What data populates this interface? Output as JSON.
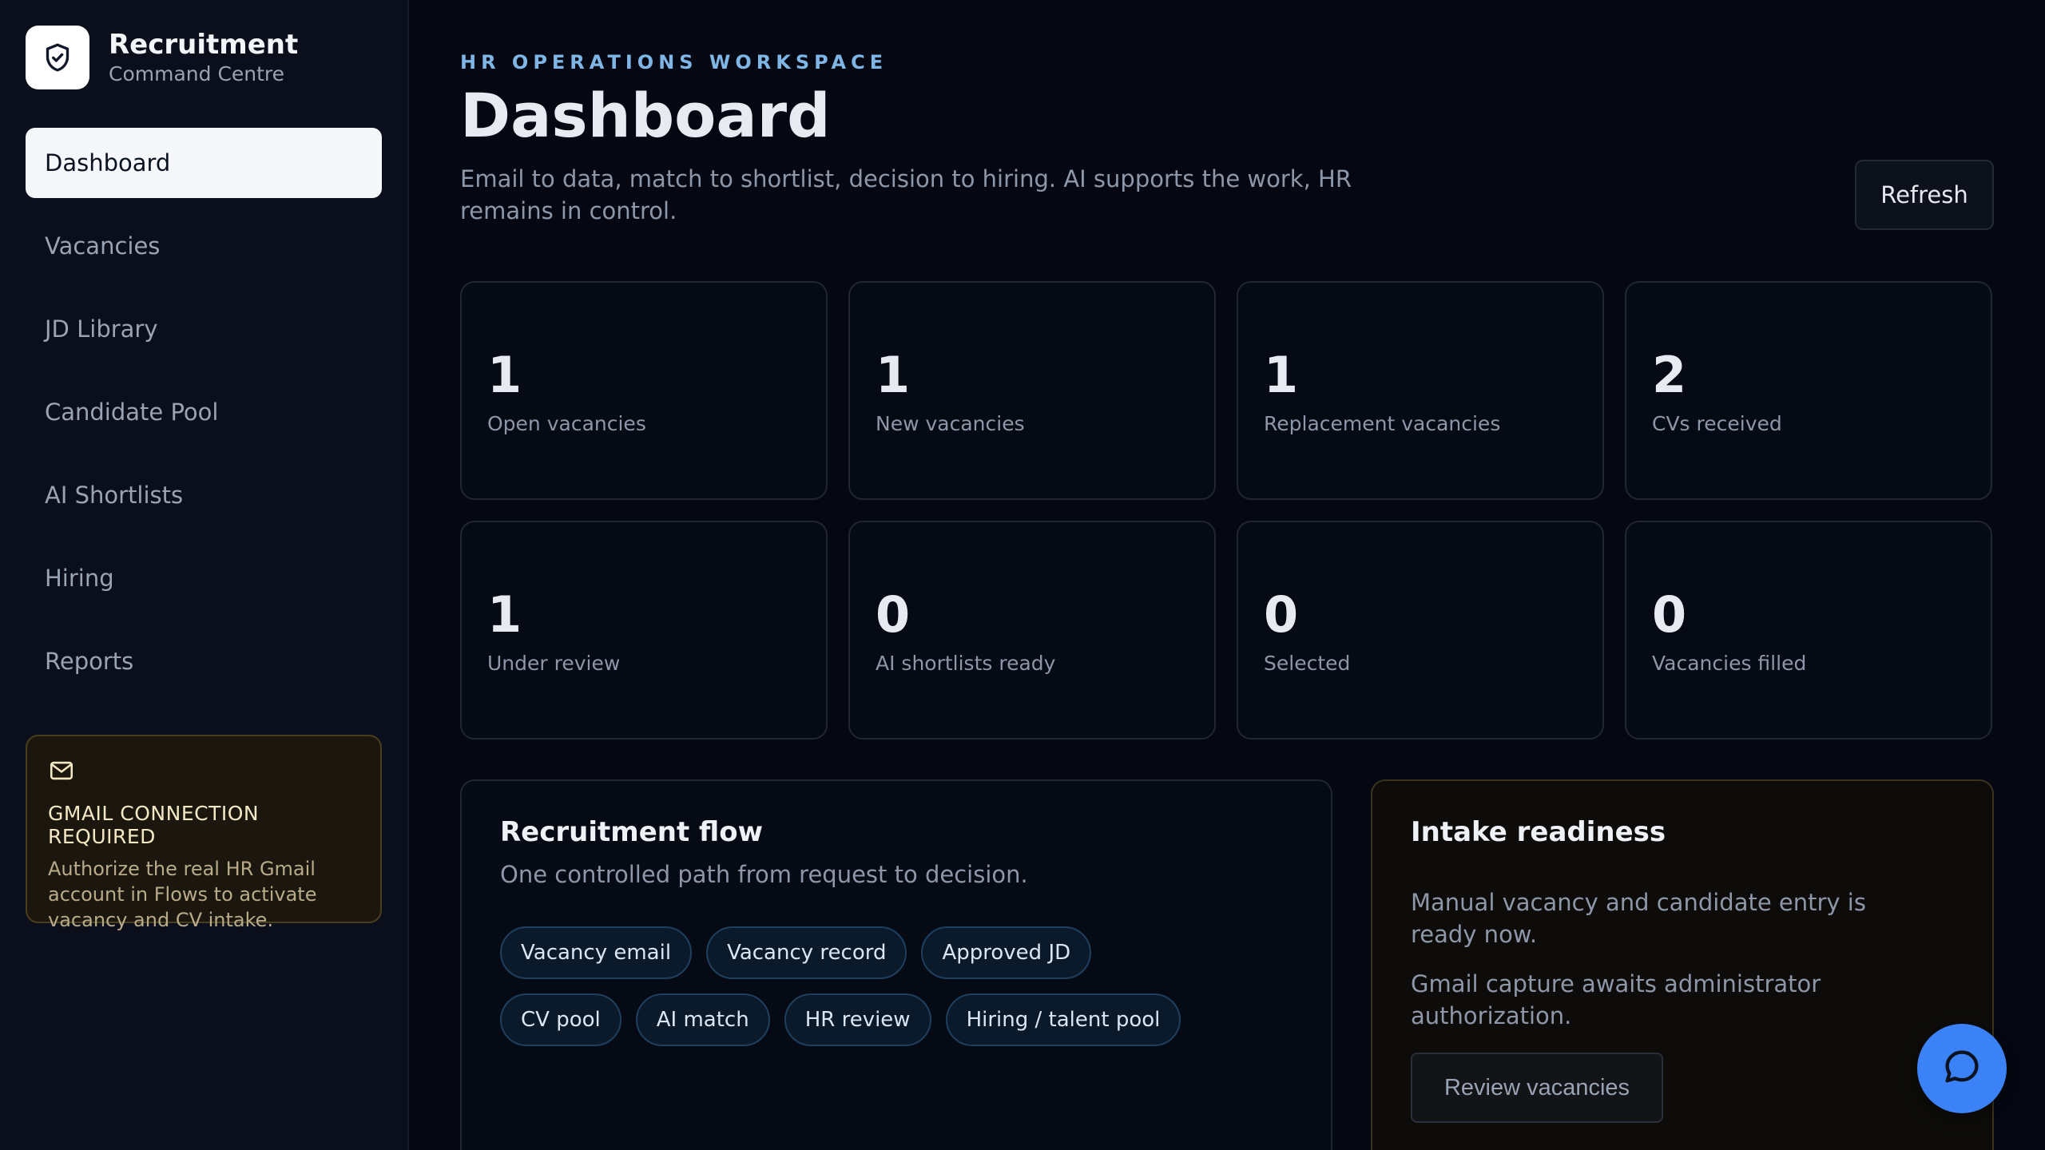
{
  "brand": {
    "title": "Recruitment",
    "subtitle": "Command Centre",
    "icon": "shield-check-icon"
  },
  "nav": {
    "items": [
      {
        "label": "Dashboard",
        "active": true
      },
      {
        "label": "Vacancies",
        "active": false
      },
      {
        "label": "JD Library",
        "active": false
      },
      {
        "label": "Candidate Pool",
        "active": false
      },
      {
        "label": "AI Shortlists",
        "active": false
      },
      {
        "label": "Hiring",
        "active": false
      },
      {
        "label": "Reports",
        "active": false
      }
    ]
  },
  "gmail_notice": {
    "icon": "mail-icon",
    "title": "GMAIL CONNECTION REQUIRED",
    "text": "Authorize the real HR Gmail account in Flows to activate vacancy and CV intake."
  },
  "header": {
    "eyebrow": "HR OPERATIONS WORKSPACE",
    "title": "Dashboard",
    "description": "Email to data, match to shortlist, decision to hiring. AI supports the work, HR remains in control.",
    "refresh_label": "Refresh"
  },
  "stats": [
    {
      "value": "1",
      "label": "Open vacancies"
    },
    {
      "value": "1",
      "label": "New vacancies"
    },
    {
      "value": "1",
      "label": "Replacement vacancies"
    },
    {
      "value": "2",
      "label": "CVs received"
    },
    {
      "value": "1",
      "label": "Under review"
    },
    {
      "value": "0",
      "label": "AI shortlists ready"
    },
    {
      "value": "0",
      "label": "Selected"
    },
    {
      "value": "0",
      "label": "Vacancies filled"
    }
  ],
  "flow": {
    "title": "Recruitment flow",
    "subtitle": "One controlled path from request to decision.",
    "steps": [
      "Vacancy email",
      "Vacancy record",
      "Approved JD",
      "CV pool",
      "AI match",
      "HR review",
      "Hiring / talent pool"
    ]
  },
  "intake": {
    "title": "Intake readiness",
    "text_manual": "Manual vacancy and candidate entry is ready now.",
    "text_gmail": "Gmail capture awaits administrator authorization.",
    "button_label": "Review vacancies"
  },
  "chat": {
    "icon": "chat-bubble-icon"
  },
  "colors": {
    "background": "#050812",
    "sidebar": "#0a0f1b",
    "accent_blue": "#3b82f6",
    "eyebrow": "#7fb6e6",
    "warning_border": "#4a3d1d"
  }
}
